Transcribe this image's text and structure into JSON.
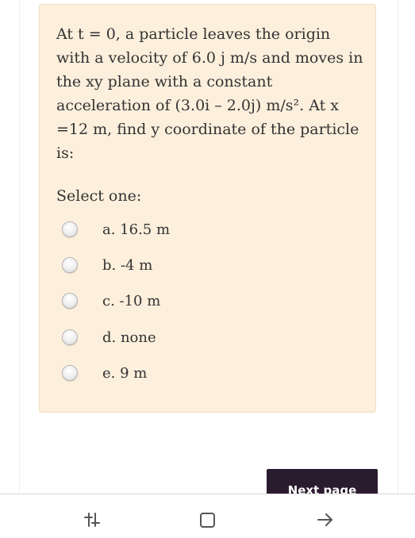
{
  "question": {
    "text": "At t = 0, a particle leaves the origin with a velocity of 6.0 j m/s and moves in the xy plane with a constant acceleration of (3.0i – 2.0j) m/s². At x =12 m, find y coordinate of the particle is:",
    "select_label": "Select one:"
  },
  "options": [
    {
      "label": "a. 16.5 m"
    },
    {
      "label": "b. -4 m"
    },
    {
      "label": "c. -10 m"
    },
    {
      "label": "d. none"
    },
    {
      "label": "e. 9 m"
    }
  ],
  "next_button": {
    "label": "Next page"
  },
  "nav_bar": {
    "icons": [
      "recent-apps-icon",
      "home-icon",
      "back-icon"
    ]
  },
  "colors": {
    "card_background": "#fcefdc",
    "card_border": "#efdcc0",
    "button_background": "#2b1b2e",
    "text": "#333333"
  }
}
